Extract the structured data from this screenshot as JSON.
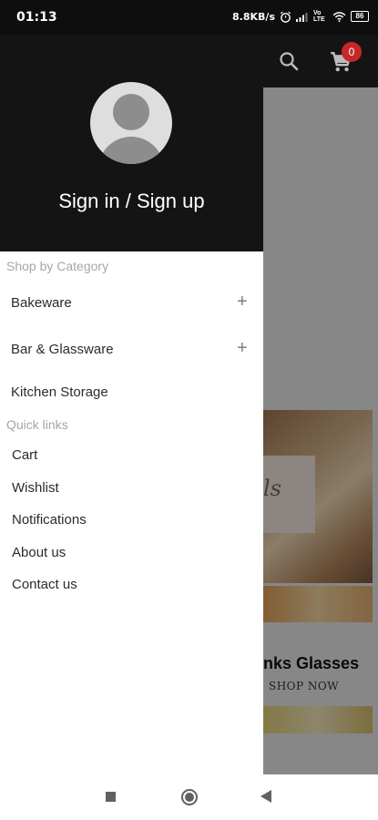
{
  "status_bar": {
    "time": "01:13",
    "network_speed": "8.8KB/s",
    "alarm_icon": "alarm-icon",
    "signal_icon": "signal-icon",
    "volte_label": "Vo LTE",
    "wifi_icon": "wifi-icon",
    "battery": "86"
  },
  "app_bar": {
    "search_icon": "search-icon",
    "cart_icon": "cart-icon",
    "cart_count": "0"
  },
  "drawer": {
    "avatar_icon": "user-avatar-icon",
    "sign_in_label": "Sign in / Sign up",
    "categories_heading": "Shop by Category",
    "categories": [
      {
        "label": "Bakeware",
        "expandable": true
      },
      {
        "label": "Bar & Glassware",
        "expandable": true
      },
      {
        "label": "Kitchen Storage",
        "expandable": false
      }
    ],
    "quick_links_heading": "Quick links",
    "quick_links": [
      {
        "label": "Cart"
      },
      {
        "label": "Wishlist"
      },
      {
        "label": "Notifications"
      },
      {
        "label": "About us"
      },
      {
        "label": "Contact us"
      }
    ],
    "expand_symbol": "+"
  },
  "background": {
    "banner_card_text": "ls",
    "banner_title": "nks Glasses",
    "banner_cta": "SHOP NOW"
  },
  "nav_bar": {
    "recents_icon": "square-icon",
    "home_icon": "home-circle-icon",
    "back_icon": "back-triangle-icon"
  }
}
